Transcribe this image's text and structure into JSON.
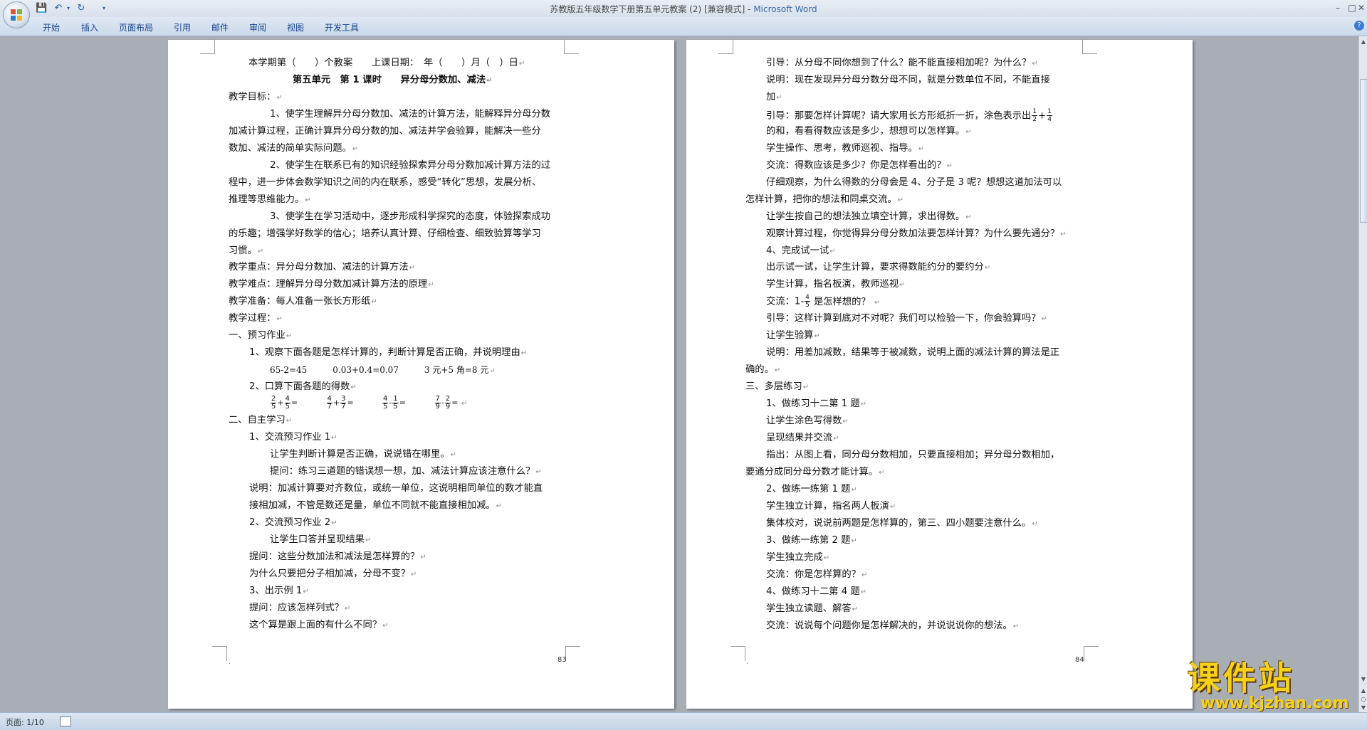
{
  "window": {
    "title": "苏教版五年级数学下册第五单元教案 (2) [兼容模式] - ",
    "app": "Microsoft Word"
  },
  "ribbon": {
    "tabs": [
      "开始",
      "插入",
      "页面布局",
      "引用",
      "邮件",
      "审阅",
      "视图",
      "开发工具"
    ]
  },
  "status": {
    "page": "页面: 1/10"
  },
  "page_left": {
    "page_number": "83",
    "lines": [
      "本学期第（　　）个教案　　上课日期：　年（　　）月（　）日",
      "第五单元　第 1 课时　　异分母分数加、减法",
      "教学目标：",
      "1、使学生理解异分母分数加、减法的计算方法，能解释异分母分数",
      "加减计算过程，正确计算异分母分数的加、减法并学会验算，能解决一些分",
      "数加、减法的简单实际问题。",
      "2、使学生在联系已有的知识经验探索异分母分数加减计算方法的过",
      "程中，进一步体会数学知识之间的内在联系，感受“转化”思想，发展分析、",
      "推理等思维能力。",
      "3、使学生在学习活动中，逐步形成科学探究的态度，体验探索成功",
      "的乐趣；增强学好数学的信心；培养认真计算、仔细检查、细致验算等学习",
      "习惯。",
      "教学重点：异分母分数加、减法的计算方法",
      "教学难点：理解异分母分数加减计算方法的原理",
      "教学准备：每人准备一张长方形纸",
      "教学过程：",
      "一、预习作业",
      "1、观察下面各题是怎样计算的，判断计算是否正确，并说明理由",
      "65-2=45　　　0.03+0.4=0.07　　　3 元+5 角=8 元",
      "2、口算下面各题的得数",
      "",
      "二、自主学习",
      "1、交流预习作业 1",
      "让学生判断计算是否正确，说说错在哪里。",
      "提问：练习三道题的错误想一想，加、减法计算应该注意什么？",
      "说明：加减计算要对齐数位，或统一单位，这说明相同单位的数才能直",
      "接相加减，不管是数还是量，单位不同就不能直接相加减。",
      "2、交流预习作业 2",
      "让学生口答并呈现结果",
      "提问：这些分数加法和减法是怎样算的？",
      "为什么只要把分子相加减，分母不变？",
      "3、出示例 1",
      "提问：应该怎样列式？",
      "这个算是跟上面的有什么不同？"
    ],
    "fractions": [
      {
        "a_num": "2",
        "a_den": "5",
        "op": "+",
        "b_num": "4",
        "b_den": "5",
        "eq": "="
      },
      {
        "a_num": "4",
        "a_den": "7",
        "op": "+",
        "b_num": "3",
        "b_den": "7",
        "eq": "="
      },
      {
        "a_num": "4",
        "a_den": "5",
        "op": "-",
        "b_num": "1",
        "b_den": "5",
        "eq": "="
      },
      {
        "a_num": "7",
        "a_den": "9",
        "op": "-",
        "b_num": "2",
        "b_den": "9",
        "eq": "="
      }
    ]
  },
  "page_right": {
    "page_number": "84",
    "lines": [
      "引导：从分母不同你想到了什么？能不能直接相加呢？为什么？",
      "说明：现在发现异分母分数分母不同，就是分数单位不同，不能直接",
      "加",
      "引导：那要怎样计算呢？请大家用长方形纸折一折，涂色表示出",
      "的和，看看得数应该是多少，想想可以怎样算。",
      "学生操作、思考，教师巡视、指导。",
      "交流：得数应该是多少？你是怎样看出的？",
      "仔细观察，为什么得数的分母会是 4、分子是 3 呢？想想这道加法可以",
      "怎样计算，把你的想法和同桌交流。",
      "让学生按自己的想法独立填空计算，求出得数。",
      "观察计算过程，你觉得异分母分数加法要怎样计算？为什么要先通分？",
      "4、完成试一试",
      "出示试一试，让学生计算，要求得数能约分的要约分",
      "学生计算，指名板演，教师巡视",
      "交流：1-",
      "是怎样想的？",
      "引导：这样计算到底对不对呢？我们可以检验一下，你会验算吗？",
      "让学生验算",
      "说明：用差加减数，结果等于被减数，说明上面的减法计算的算法是正",
      "确的。",
      "三、多层练习",
      "1、做练习十二第 1 题",
      "让学生涂色写得数",
      "呈现结果并交流",
      "指出：从图上看，同分母分数相加，只要直接相加；异分母分数相加，",
      "要通分成同分母分数才能计算。",
      "2、做练一练第 1 题",
      "学生独立计算，指名两人板演",
      "集体校对，说说前两题是怎样算的，第三、四小题要注意什么。",
      "3、做练一练第 2 题",
      "学生独立完成",
      "交流：你是怎样算的？",
      "4、做练习十二第 4 题",
      "学生独立读题、解答",
      "交流：说说每个问题你是怎样解决的，并说说说你的想法。"
    ],
    "frac_sum": {
      "a_num": "1",
      "a_den": "2",
      "op": "+",
      "b_num": "1",
      "b_den": "4"
    },
    "frac_sub": {
      "num": "4",
      "den": "5"
    }
  },
  "watermark": {
    "big": "课件站",
    "url": "www.kjzhan.com"
  }
}
